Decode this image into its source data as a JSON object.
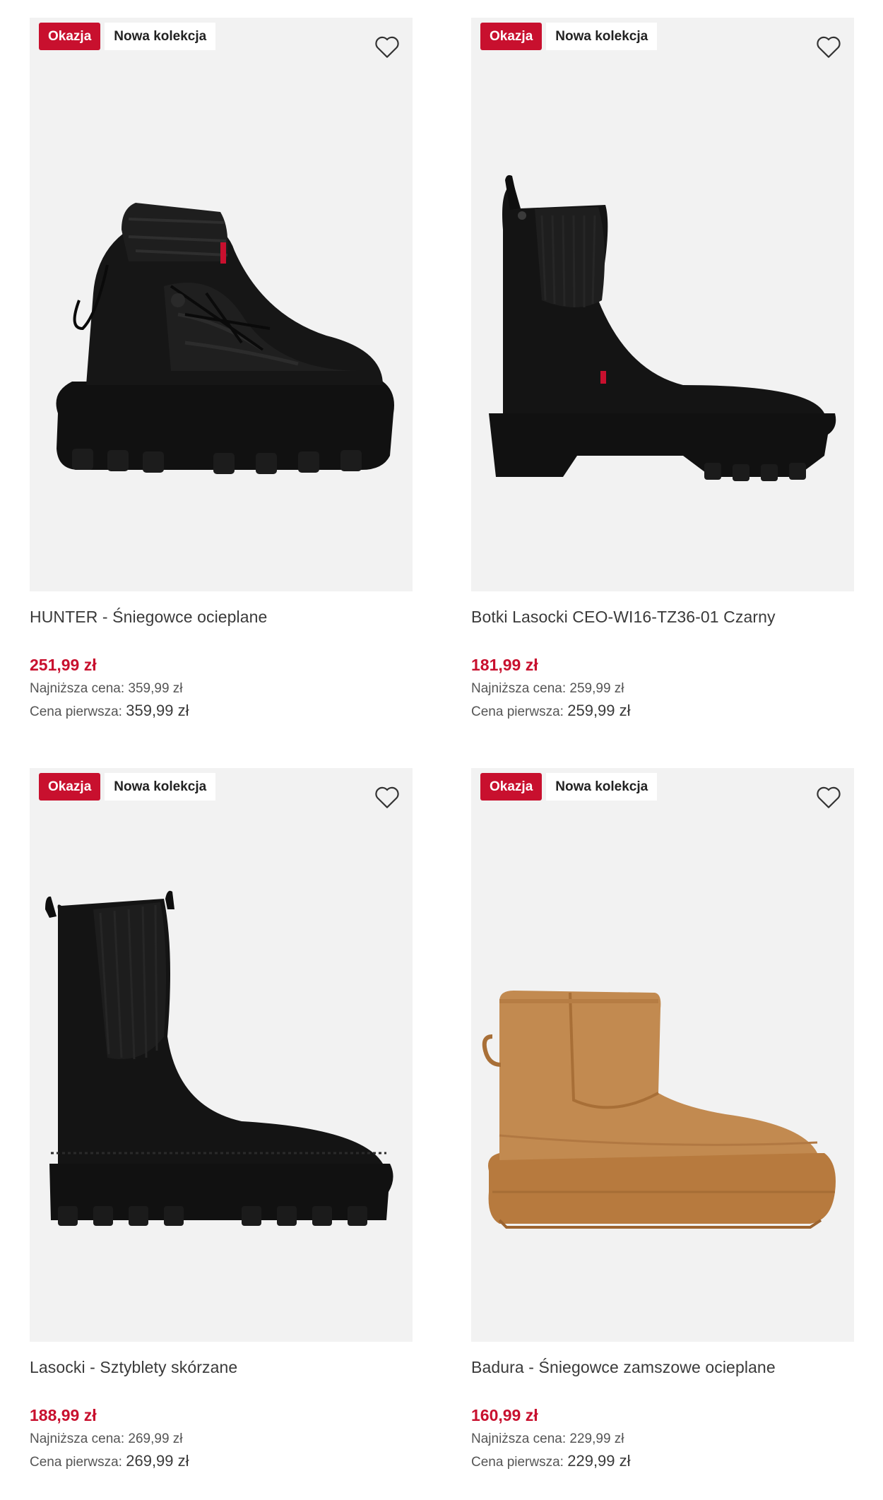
{
  "products": [
    {
      "badge_sale": "Okazja",
      "badge_new": "Nowa kolekcja",
      "name": "HUNTER - Śniegowce ocieplane",
      "price": "251,99 zł",
      "lowest_label": "Najniższa cena:",
      "lowest_value": "359,99 zł",
      "original_label": "Cena pierwsza:",
      "original_value": "359,99 zł",
      "image_icon": "black-lace-up-snow-boot"
    },
    {
      "badge_sale": "Okazja",
      "badge_new": "Nowa kolekcja",
      "name": "Botki Lasocki CEO-WI16-TZ36-01 Czarny",
      "price": "181,99 zł",
      "lowest_label": "Najniższa cena:",
      "lowest_value": "259,99 zł",
      "original_label": "Cena pierwsza:",
      "original_value": "259,99 zł",
      "image_icon": "black-chelsea-ankle-boot"
    },
    {
      "badge_sale": "Okazja",
      "badge_new": "Nowa kolekcja",
      "name": "Lasocki - Sztyblety skórzane",
      "price": "188,99 zł",
      "lowest_label": "Najniższa cena:",
      "lowest_value": "269,99 zł",
      "original_label": "Cena pierwsza:",
      "original_value": "269,99 zł",
      "image_icon": "black-tall-chelsea-boot"
    },
    {
      "badge_sale": "Okazja",
      "badge_new": "Nowa kolekcja",
      "name": "Badura - Śniegowce zamszowe ocieplane",
      "price": "160,99 zł",
      "lowest_label": "Najniższa cena:",
      "lowest_value": "229,99 zł",
      "original_label": "Cena pierwsza:",
      "original_value": "229,99 zł",
      "image_icon": "tan-suede-platform-boot"
    }
  ],
  "colors": {
    "sale_red": "#c8102e",
    "image_bg": "#f2f2f2",
    "text": "#3a3a3a"
  }
}
